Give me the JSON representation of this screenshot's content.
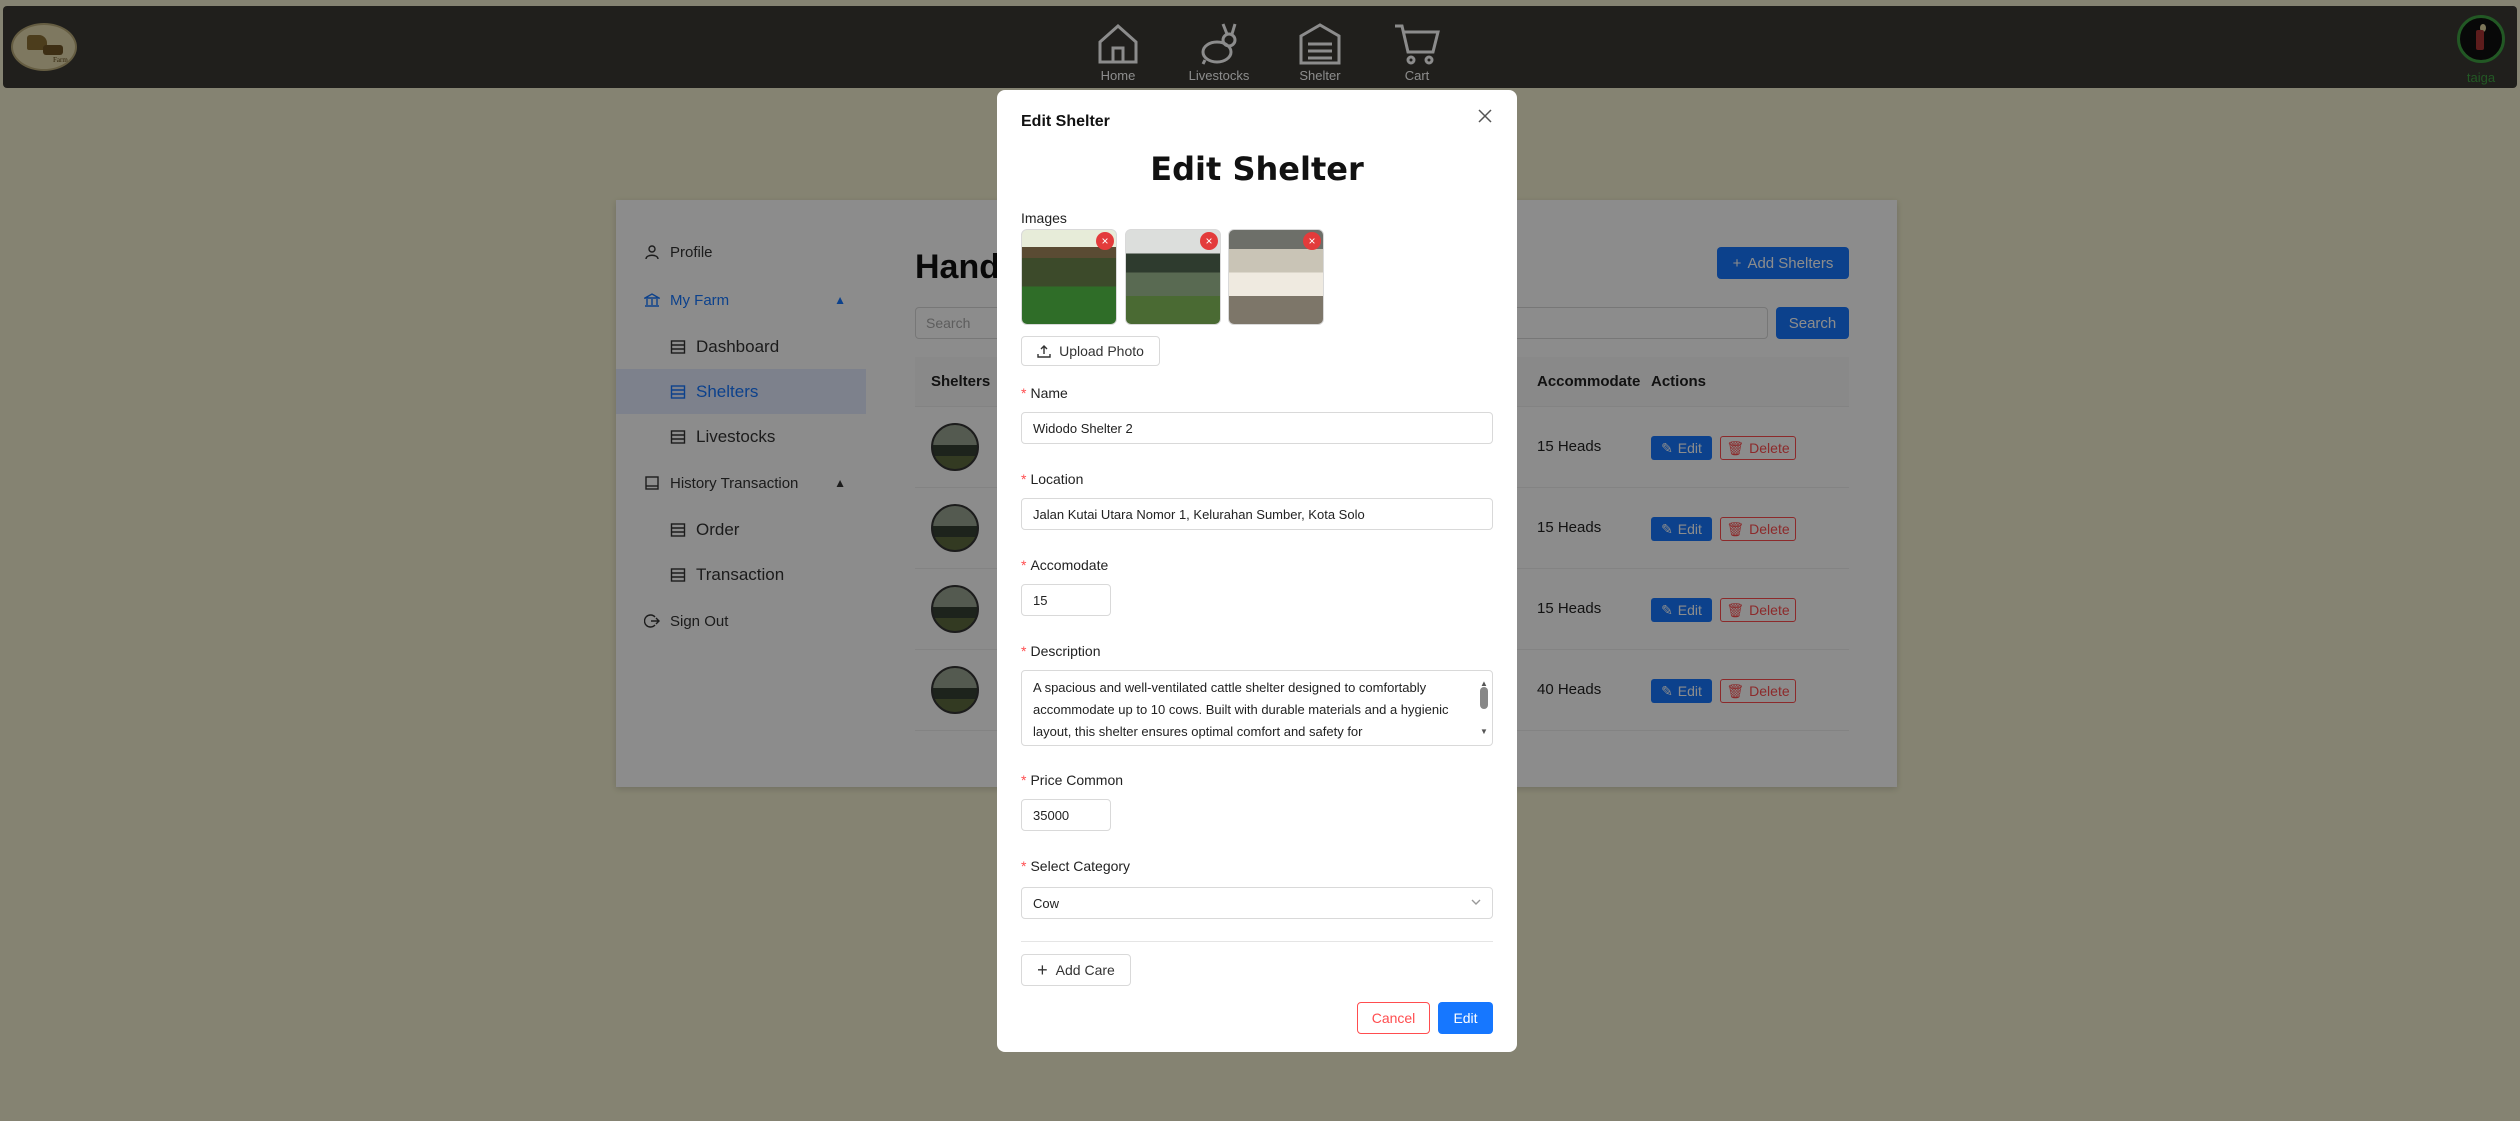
{
  "nav": {
    "items": [
      {
        "label": "Home",
        "icon": "home-icon"
      },
      {
        "label": "Livestocks",
        "icon": "rabbit-icon"
      },
      {
        "label": "Shelter",
        "icon": "shelter-icon"
      },
      {
        "label": "Cart",
        "icon": "cart-icon"
      }
    ],
    "user": "taiga"
  },
  "sidebar": {
    "items": [
      {
        "label": "Profile"
      },
      {
        "label": "My Farm"
      },
      {
        "label": "Dashboard"
      },
      {
        "label": "Shelters"
      },
      {
        "label": "Livestocks"
      },
      {
        "label": "History Transaction"
      },
      {
        "label": "Order"
      },
      {
        "label": "Transaction"
      },
      {
        "label": "Sign Out"
      }
    ]
  },
  "main": {
    "title": "Hand",
    "add_button": "Add Shelters",
    "search_placeholder": "Search",
    "search_button": "Search",
    "columns": [
      "Shelters",
      "Accommodate",
      "Actions"
    ],
    "rows": [
      {
        "accommodate": "15 Heads"
      },
      {
        "accommodate": "15 Heads"
      },
      {
        "accommodate": "15 Heads"
      },
      {
        "accommodate": "40 Heads"
      }
    ],
    "edit_label": "Edit",
    "delete_label": "Delete"
  },
  "modal": {
    "header": "Edit Shelter",
    "heading": "Edit Shelter",
    "images_label": "Images",
    "upload_label": "Upload Photo",
    "name_label": "Name",
    "name_value": "Widodo Shelter 2",
    "location_label": "Location",
    "location_value": "Jalan Kutai Utara Nomor 1, Kelurahan Sumber, Kota Solo",
    "accomodate_label": "Accomodate",
    "accomodate_value": "15",
    "description_label": "Description",
    "description_value": "A spacious and well-ventilated cattle shelter designed to comfortably accommodate up to 10 cows. Built with durable materials and a hygienic layout, this shelter ensures optimal comfort and safety for",
    "price_label": "Price Common",
    "price_value": "35000",
    "category_label": "Select Category",
    "category_value": "Cow",
    "add_care_label": "Add Care",
    "cancel_label": "Cancel",
    "submit_label": "Edit"
  },
  "colors": {
    "nav_bg": "#3b3a33",
    "page_bg": "#f2efcf",
    "primary": "#1677ff",
    "danger": "#ff4d4f",
    "user": "#3fa043"
  }
}
